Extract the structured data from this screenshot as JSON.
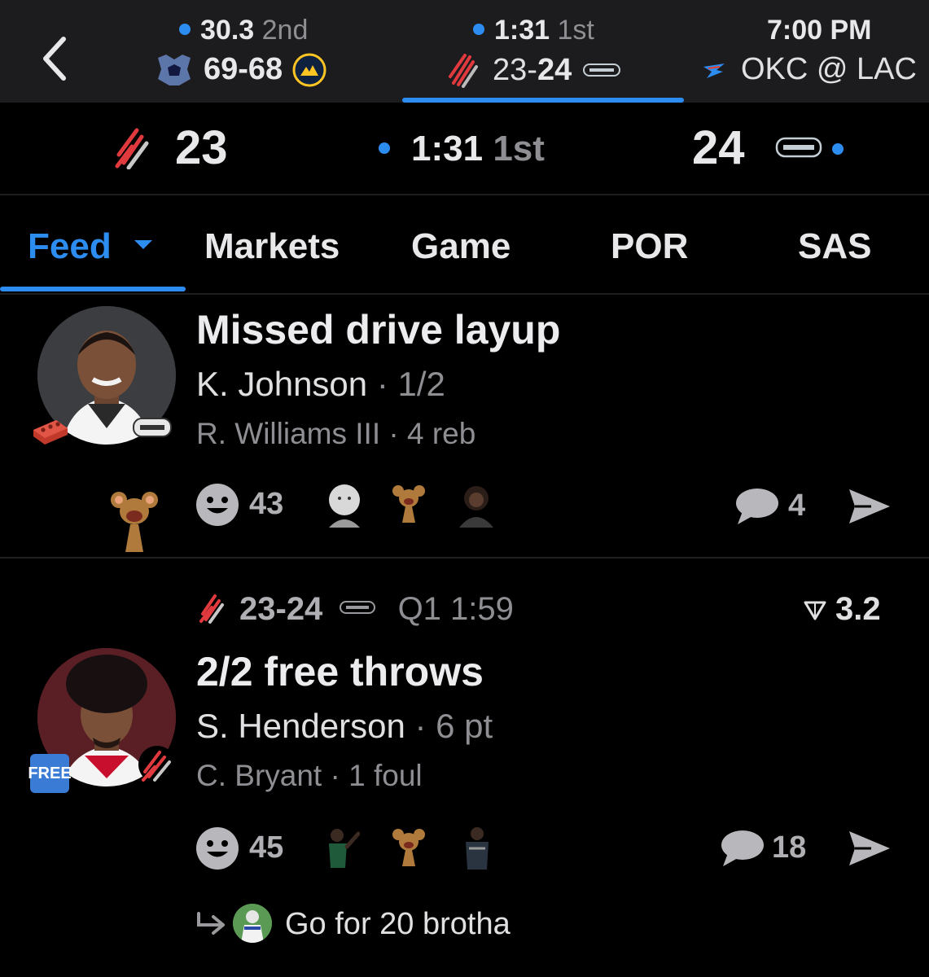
{
  "games_bar": [
    {
      "clock": "30.3",
      "period": "2nd",
      "score": "69-68"
    },
    {
      "clock": "1:31",
      "period": "1st",
      "score_away": "23",
      "score_home": "24"
    },
    {
      "time": "7:00 PM",
      "matchup": "OKC @ LAC"
    }
  ],
  "scoreboard": {
    "away_score": "23",
    "home_score": "24",
    "clock": "1:31",
    "period": "1st"
  },
  "tabs": [
    {
      "label": "Feed",
      "active": true
    },
    {
      "label": "Markets"
    },
    {
      "label": "Game"
    },
    {
      "label": "POR"
    },
    {
      "label": "SAS"
    }
  ],
  "feed": [
    {
      "headline": "Missed drive layup",
      "player": "K. Johnson",
      "player_stat": "1/2",
      "secondary_player": "R. Williams III",
      "secondary_stat": "4 reb",
      "reactions_count": "43",
      "comments_count": "4",
      "badge_icon": "brick-icon"
    },
    {
      "score": "23-24",
      "quarter_time": "Q1 1:59",
      "odds": "3.2",
      "headline": "2/2 free throws",
      "player": "S. Henderson",
      "player_stat": "6 pt",
      "secondary_player": "C. Bryant",
      "secondary_stat": "1 foul",
      "reactions_count": "45",
      "comments_count": "18",
      "badge": "FREE",
      "reply": "Go for 20 brotha"
    }
  ],
  "colors": {
    "accent": "#2d8cf0",
    "background": "#000000",
    "topbar": "#1c1c1e",
    "muted": "#8e8e93"
  }
}
